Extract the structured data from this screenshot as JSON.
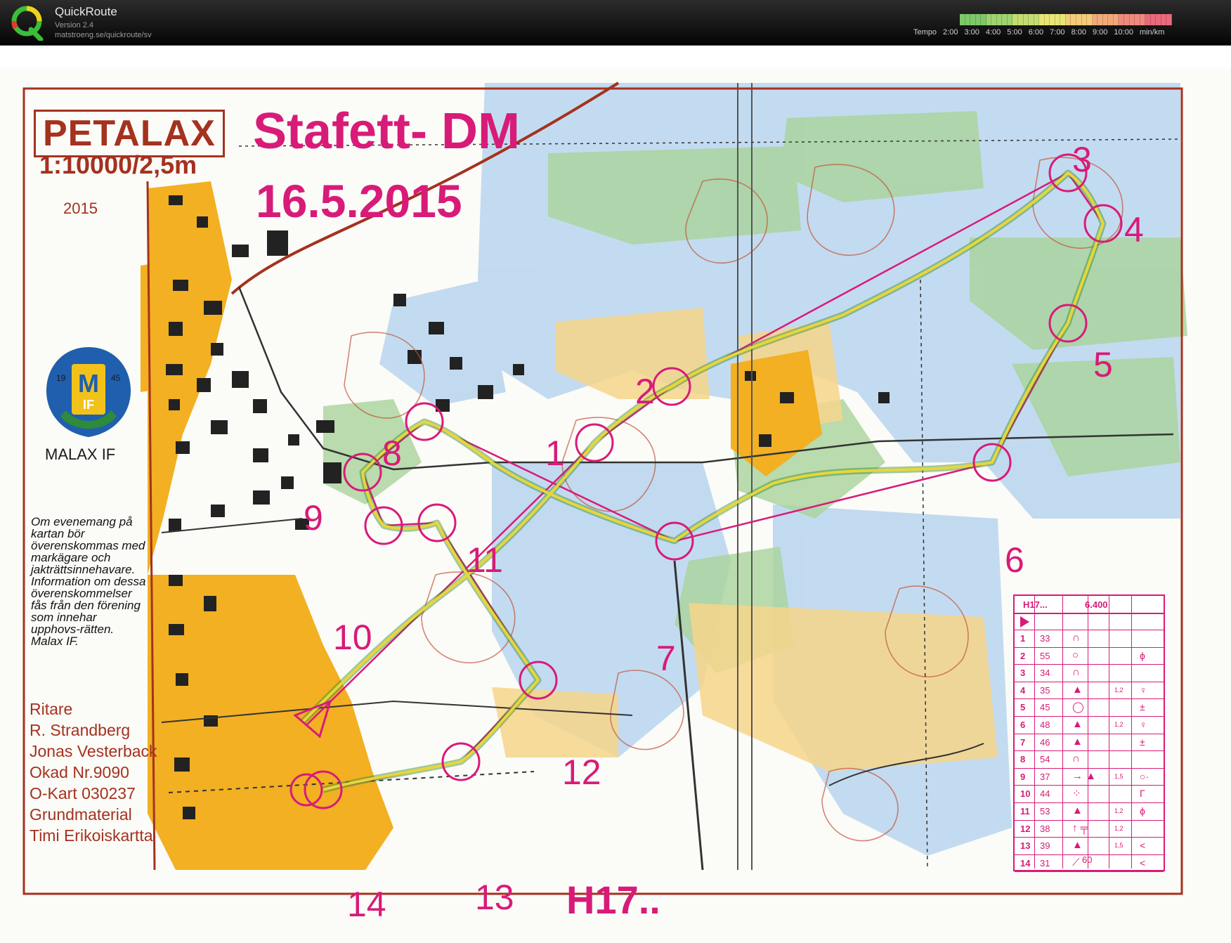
{
  "app": {
    "name": "QuickRoute",
    "version": "Version 2.4",
    "url": "matstroeng.se/quickroute/sv"
  },
  "tempo": {
    "label": "Tempo",
    "ticks": [
      "2:00",
      "3:00",
      "4:00",
      "5:00",
      "6:00",
      "7:00",
      "8:00",
      "9:00",
      "10:00"
    ],
    "unit": "min/km",
    "colors": [
      "#7ec86a",
      "#9fd36f",
      "#c4dd72",
      "#e9e676",
      "#f4cc7a",
      "#f2a97a",
      "#ee8a7e",
      "#e96a7a"
    ]
  },
  "map": {
    "area_name": "PETALAX",
    "scale": "1:10000/2,5m",
    "year": "2015",
    "event_title": "Stafett- DM",
    "event_date": "16.5.2015",
    "club_name": "MALAX IF",
    "club_logo_letters": "M",
    "club_logo_years": [
      "19",
      "45"
    ],
    "club_logo_initials": "IF",
    "permission_text": "Om evenemang på kartan bör överenskommas med markägare och jakträttsinnehavare. Information om dessa överenskommelser fås från den förening som innehar upphovs-rätten. Malax IF.",
    "credits": [
      "Ritare",
      "R. Strandberg",
      "Jonas Vesterback",
      "Okad Nr.9090",
      "O-Kart 030237",
      "Grundmaterial",
      "Timi Erikoiskartta"
    ],
    "course_id": "H17..",
    "colors": {
      "overprint": "#d81b78",
      "route": "#e7d63c",
      "border": "#a4321e"
    },
    "control_labels": [
      "1",
      "2",
      "3",
      "4",
      "5",
      "6",
      "7",
      "8",
      "9",
      "10",
      "11",
      "12",
      "13",
      "14"
    ]
  },
  "description_sheet": {
    "course": "H17...",
    "length": "6.400",
    "finish": "60",
    "controls": [
      {
        "num": "1",
        "code": "33",
        "symbol": "∩",
        "dim": "",
        "extra": ""
      },
      {
        "num": "2",
        "code": "55",
        "symbol": "○",
        "dim": "",
        "extra": "ϕ"
      },
      {
        "num": "3",
        "code": "34",
        "symbol": "∩",
        "dim": "",
        "extra": ""
      },
      {
        "num": "4",
        "code": "35",
        "symbol": "▲",
        "dim": "1,2",
        "extra": "♀"
      },
      {
        "num": "5",
        "code": "45",
        "symbol": "◯",
        "dim": "",
        "extra": "±"
      },
      {
        "num": "6",
        "code": "48",
        "symbol": "▲",
        "dim": "1,2",
        "extra": "♀"
      },
      {
        "num": "7",
        "code": "46",
        "symbol": "▲",
        "dim": "",
        "extra": "±"
      },
      {
        "num": "8",
        "code": "54",
        "symbol": "∩",
        "dim": "",
        "extra": ""
      },
      {
        "num": "9",
        "code": "37",
        "symbol": "→ ▲",
        "dim": "1,5",
        "extra": "○·"
      },
      {
        "num": "10",
        "code": "44",
        "symbol": "⁘",
        "dim": "",
        "extra": "Γ"
      },
      {
        "num": "11",
        "code": "53",
        "symbol": "▲",
        "dim": "1,2",
        "extra": "ϕ"
      },
      {
        "num": "12",
        "code": "38",
        "symbol": "↑ ╤",
        "dim": "1,2",
        "extra": ""
      },
      {
        "num": "13",
        "code": "39",
        "symbol": "▲",
        "dim": "1,5",
        "extra": "<"
      },
      {
        "num": "14",
        "code": "31",
        "symbol": "⟋",
        "dim": "",
        "extra": "<"
      }
    ]
  }
}
